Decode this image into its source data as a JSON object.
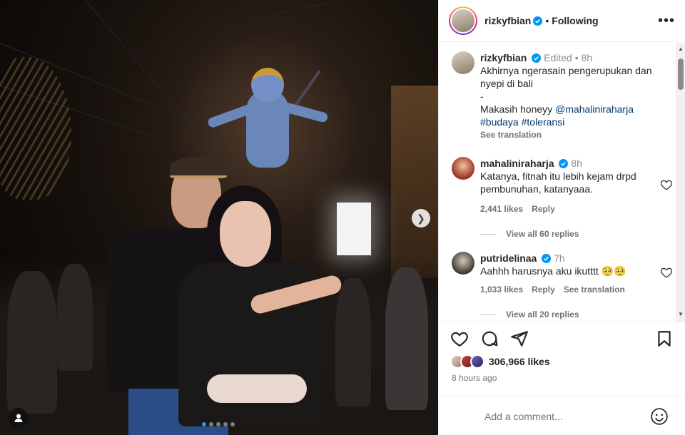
{
  "post": {
    "author": "rizkyfbian",
    "follow_state": "Following",
    "more_icon": "more-horizontal-icon",
    "image_alt_icon": "photo",
    "next_icon": "chevron-right-icon",
    "carousel_count": 5,
    "carousel_active": 0
  },
  "caption": {
    "user": "rizkyfbian",
    "edited_label": "Edited",
    "time": "8h",
    "line1": "Akhirnya ngerasain pengerupukan dan nyepi di bali",
    "line2": "-",
    "line3_prefix": "Makasih honeyy ",
    "mention": "@mahaliniraharja",
    "hashtag1": "#budaya",
    "hashtag2": "#toleransi",
    "see_translation": "See translation"
  },
  "comments": [
    {
      "user": "mahaliniraharja",
      "time": "8h",
      "text": "Katanya, fitnah itu lebih kejam drpd pembunuhan, katanyaaa.",
      "likes": "2,441 likes",
      "reply": "Reply",
      "view_replies": "View all 60 replies"
    },
    {
      "user": "putridelinaa",
      "time": "7h",
      "text": "Aahhh harusnya aku ikutttt 🥺🥺",
      "likes": "1,033 likes",
      "reply": "Reply",
      "see_translation": "See translation",
      "view_replies": "View all 20 replies"
    }
  ],
  "engagement": {
    "likes": "306,966 likes",
    "time_ago": "8 hours ago"
  },
  "composer": {
    "placeholder": "Add a comment..."
  },
  "colors": {
    "verified": "#0095f6",
    "link": "#00376b",
    "muted": "#737373",
    "carousel_active": "#2f93f0"
  }
}
